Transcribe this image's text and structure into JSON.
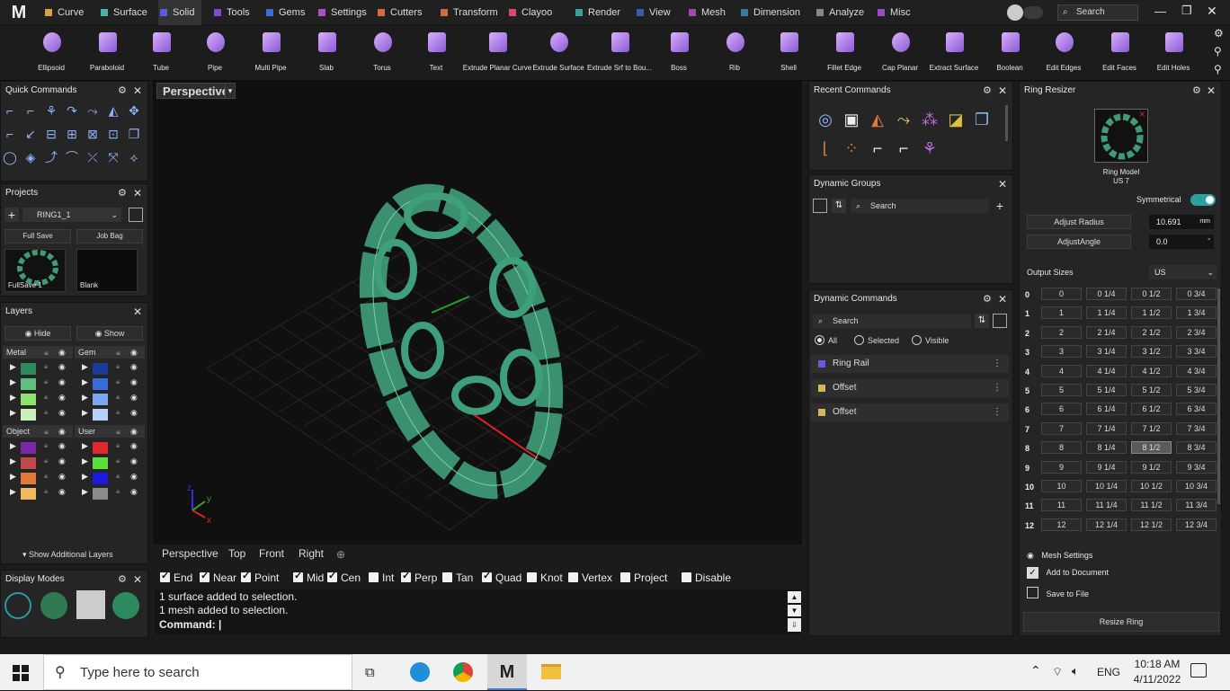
{
  "menu": {
    "tabs": [
      {
        "label": "Curve",
        "color": "#d7a14a"
      },
      {
        "label": "Surface",
        "color": "#4ab3a2"
      },
      {
        "label": "Solid",
        "color": "#5b5bdc"
      },
      {
        "label": "Tools",
        "color": "#7a4fd1"
      },
      {
        "label": "Gems",
        "color": "#3b6fd1"
      },
      {
        "label": "Settings",
        "color": "#a64fc0"
      },
      {
        "label": "Cutters",
        "color": "#d86a4a"
      },
      {
        "label": "Transform",
        "color": "#d06a4a"
      },
      {
        "label": "Clayoo",
        "color": "#d24a6a"
      },
      {
        "label": "Render",
        "color": "#3aa19a"
      },
      {
        "label": "View",
        "color": "#3a5aa9"
      },
      {
        "label": "Mesh",
        "color": "#9a4aa9"
      },
      {
        "label": "Dimension",
        "color": "#3a7a9a"
      },
      {
        "label": "Analyze",
        "color": "#888888"
      },
      {
        "label": "Misc",
        "color": "#9a4ac9"
      }
    ],
    "active_tab": "Solid",
    "search_placeholder": "Search"
  },
  "ribbon": {
    "items": [
      "Ellipsoid",
      "Paraboloid",
      "Tube",
      "Pipe",
      "Multi Pipe",
      "Slab",
      "Torus",
      "Text",
      "Extrude Planar Curve",
      "Extrude Surface",
      "Extrude Srf to Bou...",
      "Boss",
      "Rib",
      "Shell",
      "Fillet Edge",
      "Cap Planar",
      "Extract Surface",
      "Boolean",
      "Edit Edges",
      "Edit Faces",
      "Edit Holes"
    ]
  },
  "quick": {
    "title": "Quick Commands"
  },
  "projects": {
    "title": "Projects",
    "project": "RING1_1",
    "full_save": "Full Save",
    "job_bag": "Job Bag",
    "thumb1": "FullSave 1",
    "thumb2": "Blank"
  },
  "layers": {
    "title": "Layers",
    "hide": "Hide",
    "show": "Show",
    "groups": [
      "Metal",
      "Gem",
      "Object",
      "User"
    ],
    "more": "Show Additional Layers"
  },
  "display": {
    "title": "Display Modes"
  },
  "viewport": {
    "label": "Perspective",
    "tabs": [
      "Perspective",
      "Top",
      "Front",
      "Right"
    ]
  },
  "snaps": [
    {
      "label": "End",
      "on": true
    },
    {
      "label": "Near",
      "on": true
    },
    {
      "label": "Point",
      "on": true
    },
    {
      "label": "Mid",
      "on": true
    },
    {
      "label": "Cen",
      "on": true
    },
    {
      "label": "Int",
      "on": false
    },
    {
      "label": "Perp",
      "on": true
    },
    {
      "label": "Tan",
      "on": false
    },
    {
      "label": "Quad",
      "on": true
    },
    {
      "label": "Knot",
      "on": false
    },
    {
      "label": "Vertex",
      "on": false
    },
    {
      "label": "Project",
      "on": false
    },
    {
      "label": "Disable",
      "on": false
    }
  ],
  "console": {
    "line1": "1 surface added to selection.",
    "line2": "1 mesh added to selection.",
    "prompt": "Command:"
  },
  "recent": {
    "title": "Recent Commands"
  },
  "dyn_groups": {
    "title": "Dynamic Groups",
    "search": "Search"
  },
  "dyn_commands": {
    "title": "Dynamic Commands",
    "search": "Search",
    "filters": [
      "All",
      "Selected",
      "Visible"
    ],
    "rows": [
      {
        "label": "Ring Rail",
        "color": "#6a5ad8"
      },
      {
        "label": "Offset",
        "color": "#d8b45a"
      },
      {
        "label": "Offset",
        "color": "#d8b45a"
      }
    ]
  },
  "ring": {
    "title": "Ring Resizer",
    "model_label": "Ring Model",
    "model_size": "US 7",
    "symmetrical": "Symmetrical",
    "adjust_radius": "Adjust Radius",
    "radius_value": "10.691",
    "radius_unit": "mm",
    "adjust_angle": "AdjustAngle",
    "angle_value": "0.0",
    "angle_unit": "°",
    "output_sizes": "Output Sizes",
    "system": "US",
    "mesh_settings": "Mesh Settings",
    "add_doc": "Add to Document",
    "save_file": "Save to File",
    "resize": "Resize Ring",
    "rows": [
      [
        "0",
        "0",
        "0 1/4",
        "0 1/2",
        "0 3/4"
      ],
      [
        "1",
        "1",
        "1 1/4",
        "1 1/2",
        "1 3/4"
      ],
      [
        "2",
        "2",
        "2 1/4",
        "2 1/2",
        "2 3/4"
      ],
      [
        "3",
        "3",
        "3 1/4",
        "3 1/2",
        "3 3/4"
      ],
      [
        "4",
        "4",
        "4 1/4",
        "4 1/2",
        "4 3/4"
      ],
      [
        "5",
        "5",
        "5 1/4",
        "5 1/2",
        "5 3/4"
      ],
      [
        "6",
        "6",
        "6 1/4",
        "6 1/2",
        "6 3/4"
      ],
      [
        "7",
        "7",
        "7 1/4",
        "7 1/2",
        "7 3/4"
      ],
      [
        "8",
        "8",
        "8 1/4",
        "8 1/2",
        "8 3/4"
      ],
      [
        "9",
        "9",
        "9 1/4",
        "9 1/2",
        "9 3/4"
      ],
      [
        "10",
        "10",
        "10 1/4",
        "10 1/2",
        "10 3/4"
      ],
      [
        "11",
        "11",
        "11 1/4",
        "11 1/2",
        "11 3/4"
      ],
      [
        "12",
        "12",
        "12 1/4",
        "12 1/2",
        "12 3/4"
      ]
    ],
    "selected": "8 1/2"
  },
  "taskbar": {
    "search": "Type here to search",
    "time": "10:18 AM",
    "date": "4/11/2022",
    "lang": "ENG"
  }
}
